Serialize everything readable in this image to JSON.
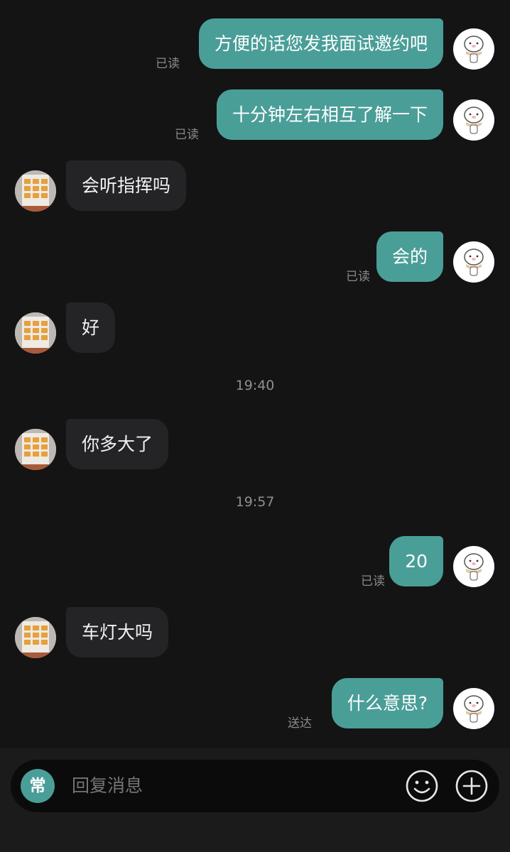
{
  "messages": [
    {
      "text": "方便的话您发我面试邀约吧",
      "status": "已读"
    },
    {
      "text": "十分钟左右相互了解一下",
      "status": "已读"
    },
    {
      "text": "会听指挥吗"
    },
    {
      "text": "会的",
      "status": "已读"
    },
    {
      "text": "好"
    },
    {
      "time": "19:40"
    },
    {
      "text": "你多大了"
    },
    {
      "time": "19:57"
    },
    {
      "text": "20",
      "status": "已读"
    },
    {
      "text": "车灯大吗"
    },
    {
      "text": "什么意思?",
      "status": "送达"
    }
  ],
  "composer": {
    "quick_phrase_label": "常",
    "placeholder": "回复消息",
    "emoji_icon": "smiley-face-icon",
    "plus_icon": "plus-circle-icon"
  },
  "colors": {
    "background": "#141414",
    "my_bubble": "#4a9e98",
    "their_bubble": "#242427",
    "status_text": "#8a8a8a"
  },
  "icons": {
    "my_avatar": "cartoon-pig-avatar-icon",
    "their_avatar": "food-poster-avatar-icon"
  }
}
